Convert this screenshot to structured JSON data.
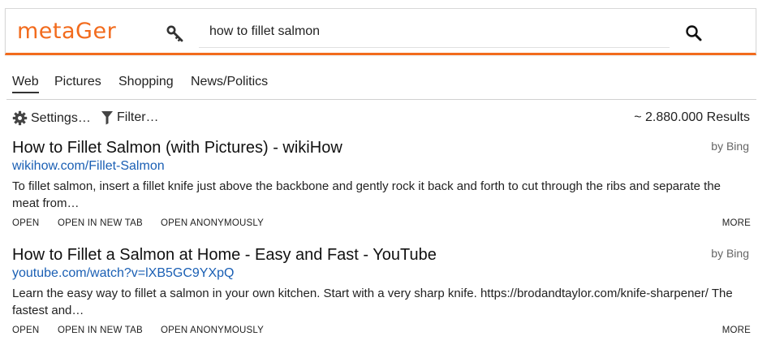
{
  "header": {
    "logo": "metaGer",
    "search": {
      "value": "how to fillet salmon",
      "placeholder": ""
    },
    "accent_color": "#f26b1d"
  },
  "tabs": [
    {
      "label": "Web",
      "active": true
    },
    {
      "label": "Pictures",
      "active": false
    },
    {
      "label": "Shopping",
      "active": false
    },
    {
      "label": "News/Politics",
      "active": false
    }
  ],
  "toolbar": {
    "settings_label": "Settings…",
    "filter_label": "Filter…",
    "results_count": "~ 2.880.000 Results"
  },
  "results": [
    {
      "title": "How to Fillet Salmon (with Pictures) - wikiHow",
      "source": "by Bing",
      "url": "wikihow.com/Fillet-Salmon",
      "description": "To fillet salmon, insert a fillet knife just above the backbone and gently rock it back and forth to cut through the ribs and separate the meat from…",
      "actions": {
        "open": "OPEN",
        "open_new_tab": "OPEN IN NEW TAB",
        "open_anon": "OPEN ANONYMOUSLY",
        "more": "MORE"
      }
    },
    {
      "title": "How to Fillet a Salmon at Home - Easy and Fast - YouTube",
      "source": "by Bing",
      "url": "youtube.com/watch?v=lXB5GC9YXpQ",
      "description": "Learn the easy way to fillet a salmon in your own kitchen. Start with a very sharp knife. https://brodandtaylor.com/knife-sharpener/ The fastest and…",
      "actions": {
        "open": "OPEN",
        "open_new_tab": "OPEN IN NEW TAB",
        "open_anon": "OPEN ANONYMOUSLY",
        "more": "MORE"
      }
    }
  ],
  "icons": {
    "key": "key-icon",
    "search": "search-icon",
    "settings": "gear-icon",
    "filter": "filter-icon"
  }
}
